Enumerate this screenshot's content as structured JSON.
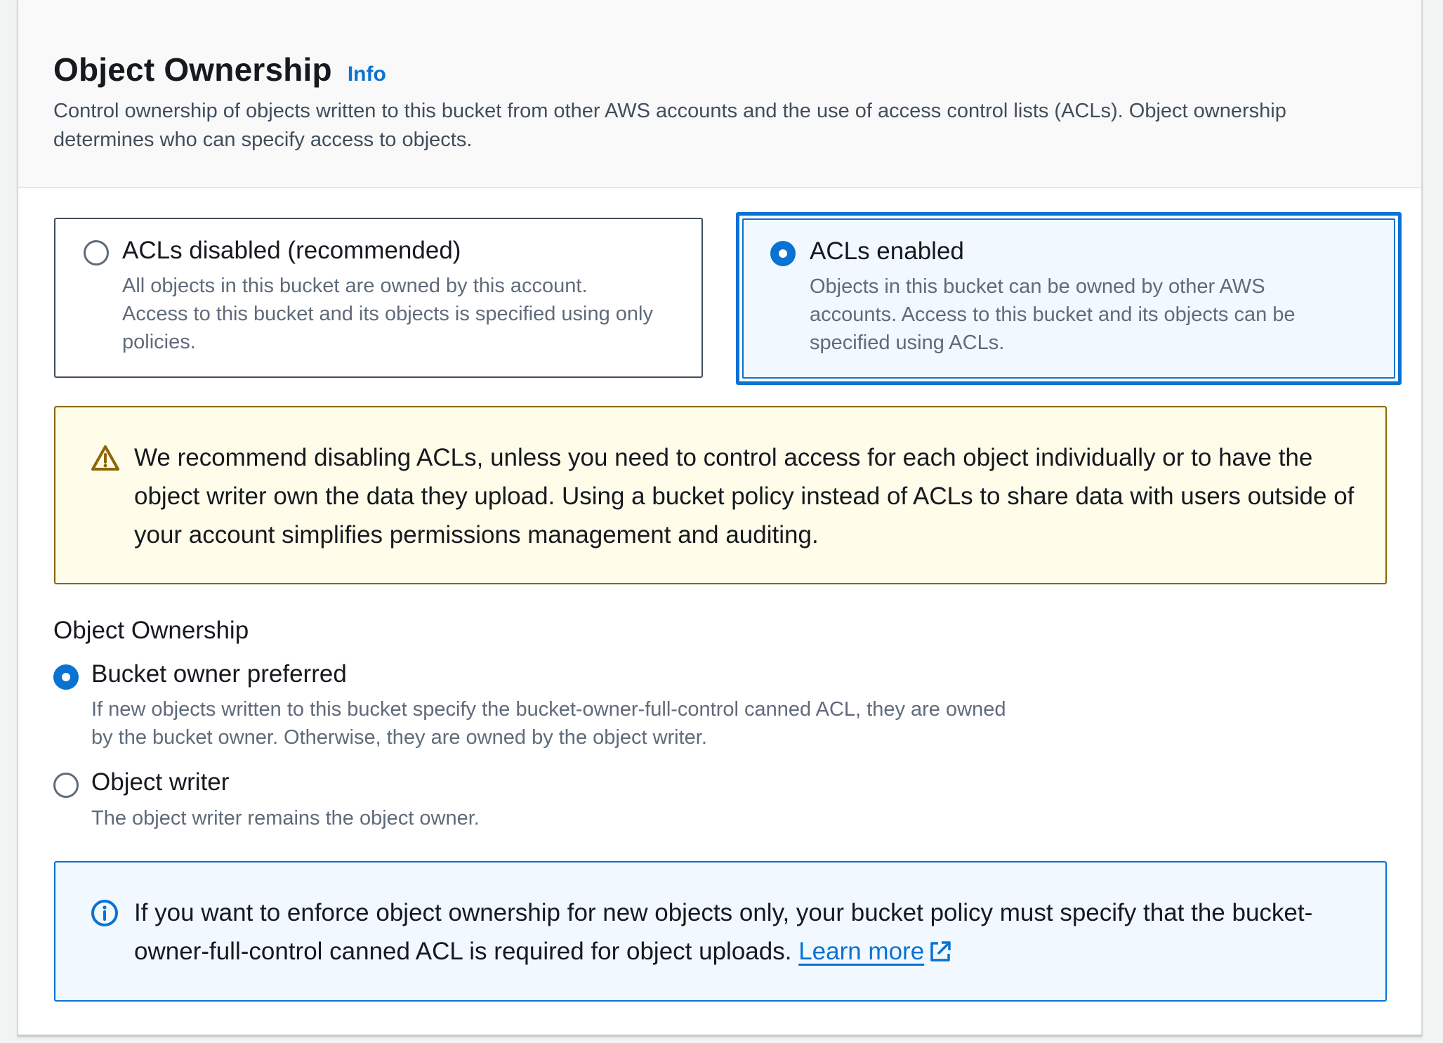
{
  "header": {
    "title": "Object Ownership",
    "info_link": "Info",
    "description": "Control ownership of objects written to this bucket from other AWS accounts and the use of access control lists (ACLs). Object ownership determines who can specify access to objects."
  },
  "acl_tiles": [
    {
      "label": "ACLs disabled (recommended)",
      "description": "All objects in this bucket are owned by this account. Access to this bucket and its objects is specified using only policies.",
      "selected": false
    },
    {
      "label": "ACLs enabled",
      "description": "Objects in this bucket can be owned by other AWS accounts. Access to this bucket and its objects can be specified using ACLs.",
      "selected": true
    }
  ],
  "warning": {
    "icon": "warning-triangle-icon",
    "text": "We recommend disabling ACLs, unless you need to control access for each object individually or to have the object writer own the data they upload. Using a bucket policy instead of ACLs to share data with users outside of your account simplifies permissions management and auditing."
  },
  "ownership": {
    "label": "Object Ownership",
    "options": [
      {
        "label": "Bucket owner preferred",
        "description": "If new objects written to this bucket specify the bucket-owner-full-control canned ACL, they are owned by the bucket owner. Otherwise, they are owned by the object writer.",
        "selected": true
      },
      {
        "label": "Object writer",
        "description": "The object writer remains the object owner.",
        "selected": false
      }
    ]
  },
  "info_note": {
    "icon": "info-circle-icon",
    "text": "If you want to enforce object ownership for new objects only, your bucket policy must specify that the bucket-owner-full-control canned ACL is required for object uploads.",
    "link": "Learn more",
    "link_icon": "external-link-icon"
  },
  "colors": {
    "accent": "#0972d3",
    "warning_border": "#8d6605",
    "warning_bg": "#fffce9",
    "info_bg": "#f1f8ff"
  }
}
